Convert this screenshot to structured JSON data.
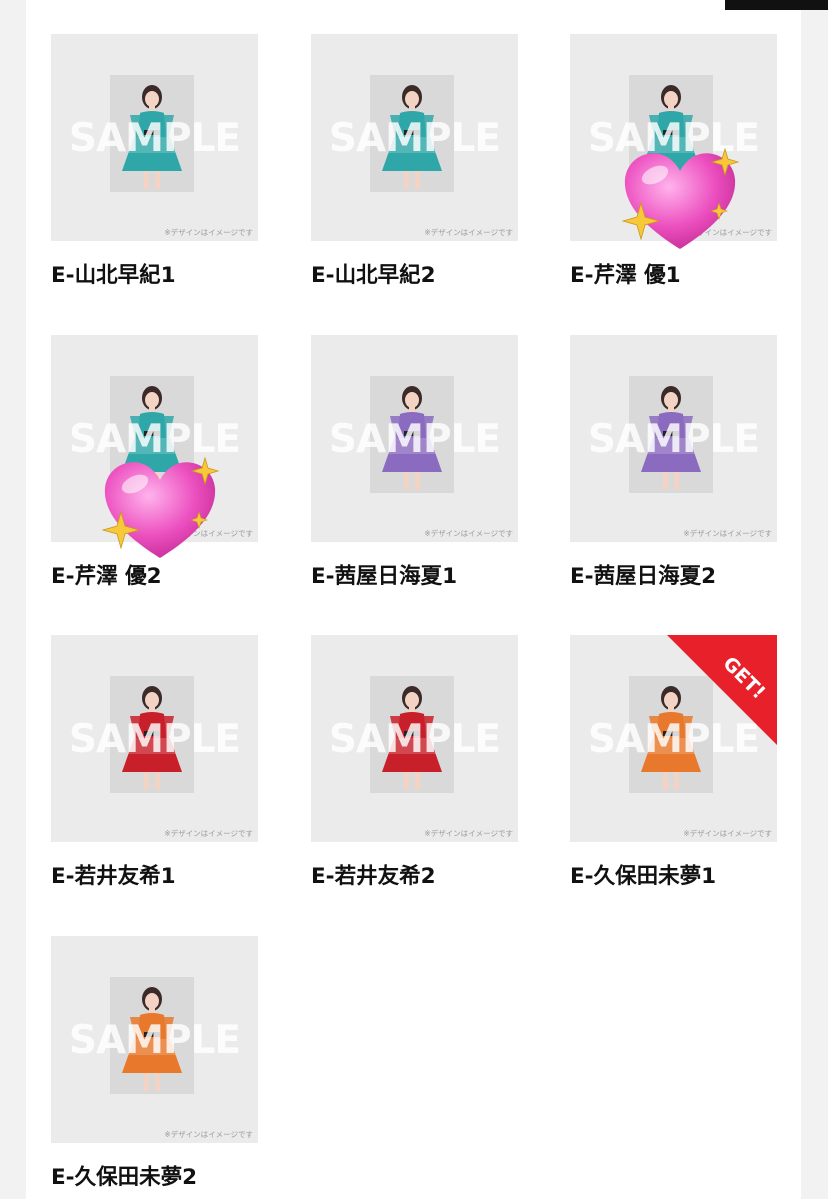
{
  "page": {
    "background": "#f2f2f2",
    "panel_color": "#ffffff",
    "topbar_tab_color": "#111111"
  },
  "common": {
    "watermark_text": "SAMPLE",
    "note_text": "※デザインはイメージです",
    "get_badge": "GET!"
  },
  "items": [
    {
      "label": "E-山北早紀1",
      "outfit": "teal",
      "sticker": false,
      "get": false
    },
    {
      "label": "E-山北早紀2",
      "outfit": "teal",
      "sticker": false,
      "get": false
    },
    {
      "label": "E-芹澤 優1",
      "outfit": "teal",
      "sticker": true,
      "get": false
    },
    {
      "label": "E-芹澤 優2",
      "outfit": "teal",
      "sticker": true,
      "get": false
    },
    {
      "label": "E-茜屋日海夏1",
      "outfit": "purple",
      "sticker": false,
      "get": false
    },
    {
      "label": "E-茜屋日海夏2",
      "outfit": "purple",
      "sticker": false,
      "get": false
    },
    {
      "label": "E-若井友希1",
      "outfit": "red",
      "sticker": false,
      "get": false
    },
    {
      "label": "E-若井友希2",
      "outfit": "red",
      "sticker": false,
      "get": false
    },
    {
      "label": "E-久保田未夢1",
      "outfit": "orange",
      "sticker": false,
      "get": true
    },
    {
      "label": "E-久保田未夢2",
      "outfit": "orange",
      "sticker": false,
      "get": false
    }
  ],
  "outfit_colors": {
    "teal": "#2fa7a8",
    "purple": "#8b6bbf",
    "red": "#c8202a",
    "orange": "#e8782c"
  },
  "accent_colors": {
    "heart": "#ec4fbf",
    "sparkle": "#f7c93a",
    "get_badge": "#e8202a"
  }
}
